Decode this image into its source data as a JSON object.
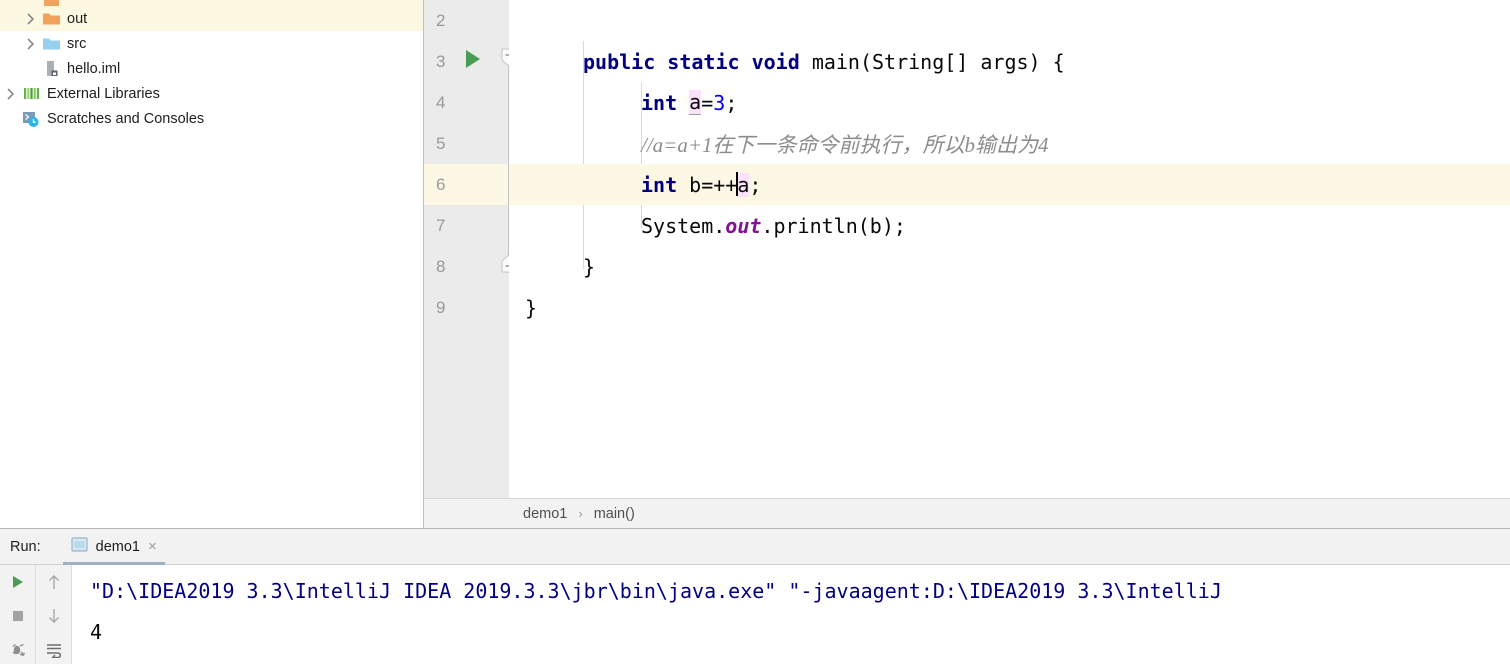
{
  "project_tree": {
    "items": [
      {
        "label": "",
        "icon": "folder-icon",
        "indent": 1,
        "expandable": true,
        "selected": false,
        "partial": true
      },
      {
        "label": "out",
        "icon": "folder-orange-icon",
        "indent": 1,
        "expandable": true,
        "selected": true,
        "partial": false
      },
      {
        "label": "src",
        "icon": "folder-blue-icon",
        "indent": 1,
        "expandable": true,
        "selected": false,
        "partial": false
      },
      {
        "label": "hello.iml",
        "icon": "iml-file-icon",
        "indent": 1,
        "expandable": false,
        "selected": false,
        "partial": false
      },
      {
        "label": "External Libraries",
        "icon": "libraries-icon",
        "indent": 0,
        "expandable": true,
        "selected": false,
        "partial": false
      },
      {
        "label": "Scratches and Consoles",
        "icon": "scratches-icon",
        "indent": 0,
        "expandable": false,
        "selected": false,
        "partial": false
      }
    ]
  },
  "editor": {
    "lines": [
      {
        "number": "2",
        "current": false
      },
      {
        "number": "3",
        "current": false
      },
      {
        "number": "4",
        "current": false
      },
      {
        "number": "5",
        "current": false
      },
      {
        "number": "6",
        "current": true
      },
      {
        "number": "7",
        "current": false
      },
      {
        "number": "8",
        "current": false
      },
      {
        "number": "9",
        "current": false
      }
    ],
    "code": {
      "line2": "",
      "line3_kw1": "public",
      "line3_kw2": "static",
      "line3_kw3": "void",
      "line3_rest": "main(String[] args) {",
      "line4_kw": "int",
      "line4_ident": "a",
      "line4_eq": "=",
      "line4_num": "3",
      "line4_semi": ";",
      "line5_comment": "//a=a+1在下一条命令前执行，所以b输出为4",
      "line6_kw": "int",
      "line6_mid": " b=++",
      "line6_ident": "a",
      "line6_semi": ";",
      "line7_pre": "System.",
      "line7_field": "out",
      "line7_post": ".println(b);",
      "line8": "}",
      "line9": "}"
    },
    "gutter_run_icon": "run-gutter-icon"
  },
  "breadcrumb": {
    "items": [
      "demo1",
      "main()"
    ],
    "separator": "›"
  },
  "run_window": {
    "label": "Run:",
    "tab_name": "demo1",
    "tab_close": "×",
    "toolbar_left": [
      "rerun-icon",
      "stop-icon",
      "debug-icon"
    ],
    "toolbar_right": [
      "up-arrow-icon",
      "down-arrow-icon",
      "soft-wrap-icon"
    ],
    "console": {
      "command": "\"D:\\IDEA2019 3.3\\IntelliJ IDEA 2019.3.3\\jbr\\bin\\java.exe\" \"-javaagent:D:\\IDEA2019 3.3\\IntelliJ",
      "output": "4"
    }
  },
  "colors": {
    "keyword": "#000080",
    "number": "#0000ff",
    "comment": "#8c8c8c",
    "field": "#871094",
    "current_line": "#fdf8e3",
    "selection": "#fdf8e2",
    "identifier_highlight": "#fbe2fb",
    "run_green": "#499c54",
    "gutter_bg": "#ebebeb",
    "panel_bg": "#f2f2f2"
  }
}
